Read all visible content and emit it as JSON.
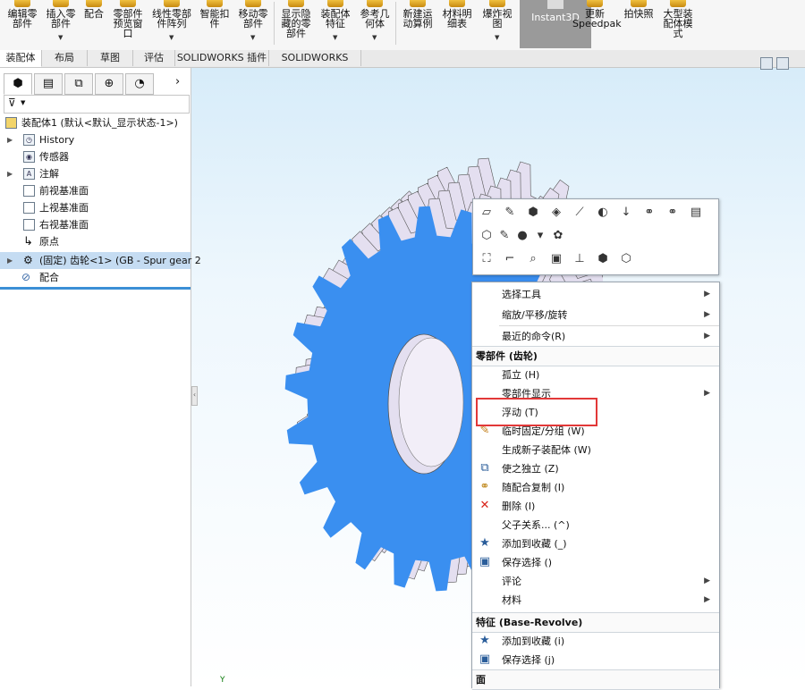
{
  "ribbon": {
    "buttons": [
      {
        "label": "编辑零\n部件"
      },
      {
        "label": "插入零\n部件"
      },
      {
        "label": "配合"
      },
      {
        "label": "零部件\n预览窗\n口"
      },
      {
        "label": "线性零部\n件阵列"
      },
      {
        "label": "智能扣\n件"
      },
      {
        "label": "移动零\n部件"
      },
      {
        "label": "显示隐\n藏的零\n部件"
      },
      {
        "label": "装配体\n特征"
      },
      {
        "label": "参考几\n何体"
      },
      {
        "label": "新建运\n动算例"
      },
      {
        "label": "材料明\n细表"
      },
      {
        "label": "爆炸视\n图"
      },
      {
        "label": "Instant3D"
      },
      {
        "label": "更新\nSpeedpak"
      },
      {
        "label": "拍快照"
      },
      {
        "label": "大型装\n配体模\n式"
      }
    ]
  },
  "tabs": [
    "装配体",
    "布局",
    "草图",
    "评估",
    "SOLIDWORKS 插件",
    "SOLIDWORKS MBD"
  ],
  "tree": {
    "root": "装配体1 (默认<默认_显示状态-1>)",
    "items": [
      "History",
      "传感器",
      "注解",
      "前视基准面",
      "上视基准面",
      "右视基准面",
      "原点",
      "(固定) 齿轮<1> (GB - Spur gear 2",
      "配合"
    ]
  },
  "axis_label": "Y",
  "context_menu": {
    "items": [
      {
        "label": "选择工具",
        "submenu": true
      },
      {
        "label": "缩放/平移/旋转",
        "submenu": true
      },
      {
        "label": "最近的命令(R)",
        "submenu": true
      },
      {
        "label": "零部件 (齿轮)",
        "header": true
      },
      {
        "label": "孤立 (H)"
      },
      {
        "label": "零部件显示",
        "submenu": true
      },
      {
        "label": "浮动 (T)"
      },
      {
        "label": "临时固定/分组 (W)"
      },
      {
        "label": "生成新子装配体 (W)"
      },
      {
        "label": "使之独立 (Z)"
      },
      {
        "label": "随配合复制 (I)"
      },
      {
        "label": "删除 (I)"
      },
      {
        "label": "父子关系... (^)"
      },
      {
        "label": "添加到收藏 (_)"
      },
      {
        "label": "保存选择 ()"
      },
      {
        "label": "评论",
        "submenu": true
      },
      {
        "label": "材料",
        "submenu": true
      },
      {
        "label": "特征 (Base-Revolve)",
        "header": true
      },
      {
        "label": "添加到收藏 (i)"
      },
      {
        "label": "保存选择 (j)"
      },
      {
        "label": "面",
        "header": true
      }
    ]
  },
  "colors": {
    "gear_face": "#3a8ff0",
    "gear_side": "#e4dff0",
    "selection_row": "#c5dcf2",
    "highlight_box": "#e23838",
    "ribbon_active": "#9a9a9a"
  }
}
